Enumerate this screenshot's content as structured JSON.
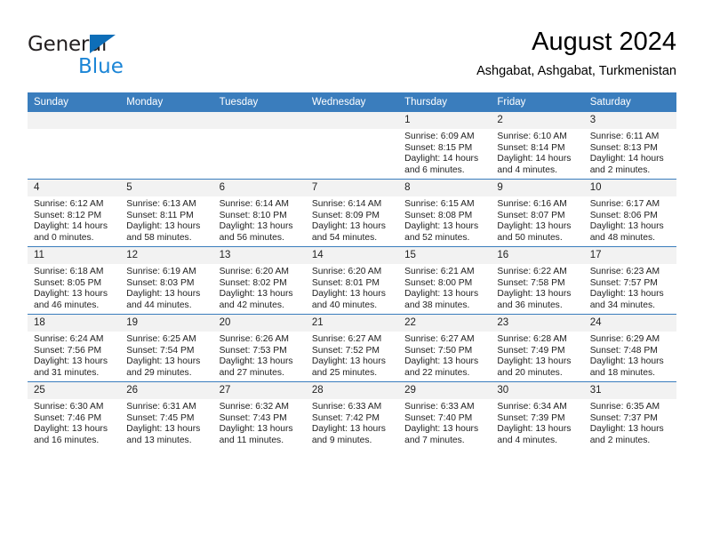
{
  "brand": {
    "name_part1": "General",
    "name_part2": "Blue"
  },
  "header": {
    "month_title": "August 2024",
    "location": "Ashgabat, Ashgabat, Turkmenistan"
  },
  "colors": {
    "header_blue": "#3a7dbd",
    "logo_blue": "#1b85d6",
    "daynum_bg": "#f2f2f2"
  },
  "weekday_headers": [
    "Sunday",
    "Monday",
    "Tuesday",
    "Wednesday",
    "Thursday",
    "Friday",
    "Saturday"
  ],
  "weeks": [
    [
      {
        "day": "",
        "empty": true,
        "sunrise": "",
        "sunset": "",
        "daylight1": "",
        "daylight2": ""
      },
      {
        "day": "",
        "empty": true,
        "sunrise": "",
        "sunset": "",
        "daylight1": "",
        "daylight2": ""
      },
      {
        "day": "",
        "empty": true,
        "sunrise": "",
        "sunset": "",
        "daylight1": "",
        "daylight2": ""
      },
      {
        "day": "",
        "empty": true,
        "sunrise": "",
        "sunset": "",
        "daylight1": "",
        "daylight2": ""
      },
      {
        "day": "1",
        "empty": false,
        "sunrise": "Sunrise: 6:09 AM",
        "sunset": "Sunset: 8:15 PM",
        "daylight1": "Daylight: 14 hours",
        "daylight2": "and 6 minutes."
      },
      {
        "day": "2",
        "empty": false,
        "sunrise": "Sunrise: 6:10 AM",
        "sunset": "Sunset: 8:14 PM",
        "daylight1": "Daylight: 14 hours",
        "daylight2": "and 4 minutes."
      },
      {
        "day": "3",
        "empty": false,
        "sunrise": "Sunrise: 6:11 AM",
        "sunset": "Sunset: 8:13 PM",
        "daylight1": "Daylight: 14 hours",
        "daylight2": "and 2 minutes."
      }
    ],
    [
      {
        "day": "4",
        "empty": false,
        "sunrise": "Sunrise: 6:12 AM",
        "sunset": "Sunset: 8:12 PM",
        "daylight1": "Daylight: 14 hours",
        "daylight2": "and 0 minutes."
      },
      {
        "day": "5",
        "empty": false,
        "sunrise": "Sunrise: 6:13 AM",
        "sunset": "Sunset: 8:11 PM",
        "daylight1": "Daylight: 13 hours",
        "daylight2": "and 58 minutes."
      },
      {
        "day": "6",
        "empty": false,
        "sunrise": "Sunrise: 6:14 AM",
        "sunset": "Sunset: 8:10 PM",
        "daylight1": "Daylight: 13 hours",
        "daylight2": "and 56 minutes."
      },
      {
        "day": "7",
        "empty": false,
        "sunrise": "Sunrise: 6:14 AM",
        "sunset": "Sunset: 8:09 PM",
        "daylight1": "Daylight: 13 hours",
        "daylight2": "and 54 minutes."
      },
      {
        "day": "8",
        "empty": false,
        "sunrise": "Sunrise: 6:15 AM",
        "sunset": "Sunset: 8:08 PM",
        "daylight1": "Daylight: 13 hours",
        "daylight2": "and 52 minutes."
      },
      {
        "day": "9",
        "empty": false,
        "sunrise": "Sunrise: 6:16 AM",
        "sunset": "Sunset: 8:07 PM",
        "daylight1": "Daylight: 13 hours",
        "daylight2": "and 50 minutes."
      },
      {
        "day": "10",
        "empty": false,
        "sunrise": "Sunrise: 6:17 AM",
        "sunset": "Sunset: 8:06 PM",
        "daylight1": "Daylight: 13 hours",
        "daylight2": "and 48 minutes."
      }
    ],
    [
      {
        "day": "11",
        "empty": false,
        "sunrise": "Sunrise: 6:18 AM",
        "sunset": "Sunset: 8:05 PM",
        "daylight1": "Daylight: 13 hours",
        "daylight2": "and 46 minutes."
      },
      {
        "day": "12",
        "empty": false,
        "sunrise": "Sunrise: 6:19 AM",
        "sunset": "Sunset: 8:03 PM",
        "daylight1": "Daylight: 13 hours",
        "daylight2": "and 44 minutes."
      },
      {
        "day": "13",
        "empty": false,
        "sunrise": "Sunrise: 6:20 AM",
        "sunset": "Sunset: 8:02 PM",
        "daylight1": "Daylight: 13 hours",
        "daylight2": "and 42 minutes."
      },
      {
        "day": "14",
        "empty": false,
        "sunrise": "Sunrise: 6:20 AM",
        "sunset": "Sunset: 8:01 PM",
        "daylight1": "Daylight: 13 hours",
        "daylight2": "and 40 minutes."
      },
      {
        "day": "15",
        "empty": false,
        "sunrise": "Sunrise: 6:21 AM",
        "sunset": "Sunset: 8:00 PM",
        "daylight1": "Daylight: 13 hours",
        "daylight2": "and 38 minutes."
      },
      {
        "day": "16",
        "empty": false,
        "sunrise": "Sunrise: 6:22 AM",
        "sunset": "Sunset: 7:58 PM",
        "daylight1": "Daylight: 13 hours",
        "daylight2": "and 36 minutes."
      },
      {
        "day": "17",
        "empty": false,
        "sunrise": "Sunrise: 6:23 AM",
        "sunset": "Sunset: 7:57 PM",
        "daylight1": "Daylight: 13 hours",
        "daylight2": "and 34 minutes."
      }
    ],
    [
      {
        "day": "18",
        "empty": false,
        "sunrise": "Sunrise: 6:24 AM",
        "sunset": "Sunset: 7:56 PM",
        "daylight1": "Daylight: 13 hours",
        "daylight2": "and 31 minutes."
      },
      {
        "day": "19",
        "empty": false,
        "sunrise": "Sunrise: 6:25 AM",
        "sunset": "Sunset: 7:54 PM",
        "daylight1": "Daylight: 13 hours",
        "daylight2": "and 29 minutes."
      },
      {
        "day": "20",
        "empty": false,
        "sunrise": "Sunrise: 6:26 AM",
        "sunset": "Sunset: 7:53 PM",
        "daylight1": "Daylight: 13 hours",
        "daylight2": "and 27 minutes."
      },
      {
        "day": "21",
        "empty": false,
        "sunrise": "Sunrise: 6:27 AM",
        "sunset": "Sunset: 7:52 PM",
        "daylight1": "Daylight: 13 hours",
        "daylight2": "and 25 minutes."
      },
      {
        "day": "22",
        "empty": false,
        "sunrise": "Sunrise: 6:27 AM",
        "sunset": "Sunset: 7:50 PM",
        "daylight1": "Daylight: 13 hours",
        "daylight2": "and 22 minutes."
      },
      {
        "day": "23",
        "empty": false,
        "sunrise": "Sunrise: 6:28 AM",
        "sunset": "Sunset: 7:49 PM",
        "daylight1": "Daylight: 13 hours",
        "daylight2": "and 20 minutes."
      },
      {
        "day": "24",
        "empty": false,
        "sunrise": "Sunrise: 6:29 AM",
        "sunset": "Sunset: 7:48 PM",
        "daylight1": "Daylight: 13 hours",
        "daylight2": "and 18 minutes."
      }
    ],
    [
      {
        "day": "25",
        "empty": false,
        "sunrise": "Sunrise: 6:30 AM",
        "sunset": "Sunset: 7:46 PM",
        "daylight1": "Daylight: 13 hours",
        "daylight2": "and 16 minutes."
      },
      {
        "day": "26",
        "empty": false,
        "sunrise": "Sunrise: 6:31 AM",
        "sunset": "Sunset: 7:45 PM",
        "daylight1": "Daylight: 13 hours",
        "daylight2": "and 13 minutes."
      },
      {
        "day": "27",
        "empty": false,
        "sunrise": "Sunrise: 6:32 AM",
        "sunset": "Sunset: 7:43 PM",
        "daylight1": "Daylight: 13 hours",
        "daylight2": "and 11 minutes."
      },
      {
        "day": "28",
        "empty": false,
        "sunrise": "Sunrise: 6:33 AM",
        "sunset": "Sunset: 7:42 PM",
        "daylight1": "Daylight: 13 hours",
        "daylight2": "and 9 minutes."
      },
      {
        "day": "29",
        "empty": false,
        "sunrise": "Sunrise: 6:33 AM",
        "sunset": "Sunset: 7:40 PM",
        "daylight1": "Daylight: 13 hours",
        "daylight2": "and 7 minutes."
      },
      {
        "day": "30",
        "empty": false,
        "sunrise": "Sunrise: 6:34 AM",
        "sunset": "Sunset: 7:39 PM",
        "daylight1": "Daylight: 13 hours",
        "daylight2": "and 4 minutes."
      },
      {
        "day": "31",
        "empty": false,
        "sunrise": "Sunrise: 6:35 AM",
        "sunset": "Sunset: 7:37 PM",
        "daylight1": "Daylight: 13 hours",
        "daylight2": "and 2 minutes."
      }
    ]
  ]
}
